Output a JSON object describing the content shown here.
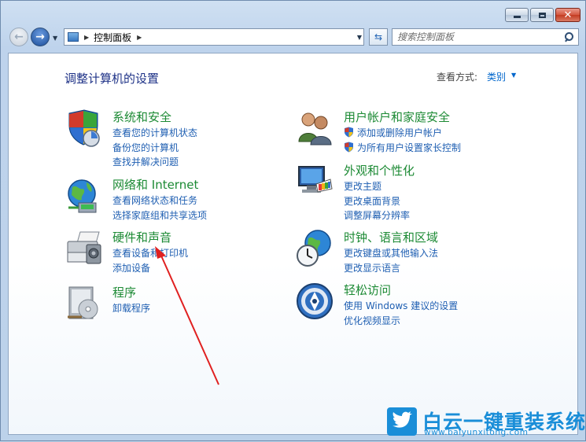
{
  "window": {
    "caption_buttons": [
      "minimize-icon",
      "maximize-icon",
      "close-icon"
    ]
  },
  "nav": {
    "back_icon": "back-arrow-icon",
    "forward_icon": "forward-arrow-icon",
    "address": {
      "crumb": "控制面板",
      "icon": "control-panel-icon"
    },
    "search_placeholder": "搜索控制面板"
  },
  "main": {
    "title": "调整计算机的设置",
    "view_by_label": "查看方式:",
    "view_by_value": "类别",
    "categories": [
      {
        "id": "system-security",
        "icon": "shield-icon",
        "title": "系统和安全",
        "links": [
          "查看您的计算机状态",
          "备份您的计算机",
          "查找并解决问题"
        ]
      },
      {
        "id": "network-internet",
        "icon": "globe-network-icon",
        "title": "网络和 Internet",
        "links": [
          "查看网络状态和任务",
          "选择家庭组和共享选项"
        ]
      },
      {
        "id": "hardware-sound",
        "icon": "printer-icon",
        "title": "硬件和声音",
        "links": [
          "查看设备和打印机",
          "添加设备"
        ]
      },
      {
        "id": "programs",
        "icon": "programs-icon",
        "title": "程序",
        "links": [
          "卸载程序"
        ]
      },
      {
        "id": "user-accounts",
        "icon": "users-icon",
        "title": "用户帐户和家庭安全",
        "links": [
          "添加或删除用户帐户",
          "为所有用户设置家长控制"
        ]
      },
      {
        "id": "appearance",
        "icon": "monitor-palette-icon",
        "title": "外观和个性化",
        "links": [
          "更改主题",
          "更改桌面背景",
          "调整屏幕分辨率"
        ]
      },
      {
        "id": "clock-region",
        "icon": "clock-globe-icon",
        "title": "时钟、语言和区域",
        "links": [
          "更改键盘或其他输入法",
          "更改显示语言"
        ]
      },
      {
        "id": "ease-of-access",
        "icon": "ease-of-access-icon",
        "title": "轻松访问",
        "links": [
          "使用 Windows 建议的设置",
          "优化视频显示"
        ]
      }
    ]
  },
  "watermark": {
    "brand": "白云一键重装系统",
    "url": "www.baiyunxitong.com",
    "icon": "twitter-bird-icon"
  },
  "colors": {
    "category_title": "#1c8a34",
    "link": "#1f5fb2",
    "page_title": "#1e3287",
    "annotation_arrow": "#e02020",
    "watermark": "#1a8ed8"
  }
}
